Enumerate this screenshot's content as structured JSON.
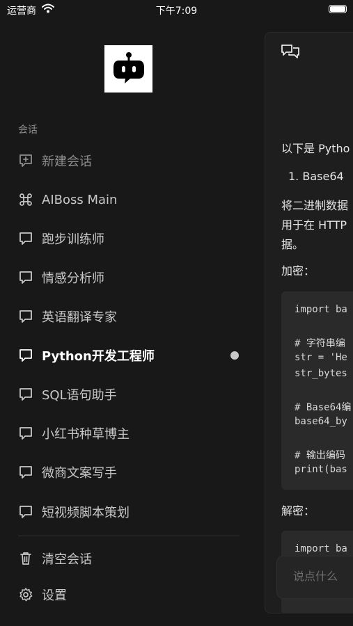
{
  "status": {
    "carrier": "运营商",
    "time": "下午7:09"
  },
  "sidebar": {
    "section_label": "会话",
    "new_chat": "新建会话",
    "items": [
      {
        "label": "AIBoss Main",
        "icon": "command-icon"
      },
      {
        "label": "跑步训练师",
        "icon": "chat-bubble-icon"
      },
      {
        "label": "情感分析师",
        "icon": "chat-bubble-icon"
      },
      {
        "label": "英语翻译专家",
        "icon": "chat-bubble-icon"
      },
      {
        "label": "Python开发工程师",
        "icon": "chat-bubble-icon"
      },
      {
        "label": "SQL语句助手",
        "icon": "chat-bubble-icon"
      },
      {
        "label": "小红书种草博主",
        "icon": "chat-bubble-icon"
      },
      {
        "label": "微商文案写手",
        "icon": "chat-bubble-icon"
      },
      {
        "label": "短视频脚本策划",
        "icon": "chat-bubble-icon"
      }
    ],
    "active_item": "Python开发工程师",
    "clear_label": "清空会话",
    "settings_label": "设置"
  },
  "chat": {
    "intro": "以下是 Pytho",
    "list_item": "1.  Base64",
    "para_line1": "将二进制数据",
    "para_line2": "用于在 HTTP",
    "para_line3": "据。",
    "encrypt_label": "加密：",
    "code1": [
      "import ba",
      "",
      "# 字符串编",
      "str = 'He",
      "str_bytes",
      "",
      "# Base64编",
      "base64_by",
      "",
      "# 输出编码",
      "print(bas"
    ],
    "decrypt_label": "解密：",
    "code2": [
      "import ba"
    ],
    "input_placeholder": "说点什么"
  }
}
